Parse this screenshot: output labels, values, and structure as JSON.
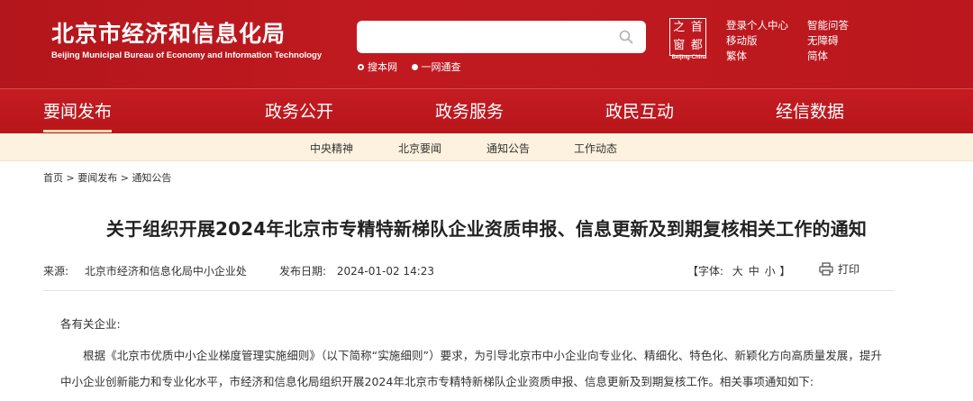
{
  "header": {
    "logo_cn": "北京市经济和信息化局",
    "logo_en": "Beijing Municipal Bureau of Economy and Information Technology",
    "search": {
      "placeholder": "",
      "options": [
        {
          "label": "搜本网",
          "selected": true
        },
        {
          "label": "一网通查",
          "selected": false
        }
      ]
    },
    "seal": {
      "chars": [
        "之",
        "首",
        "窗",
        "都"
      ],
      "caption": "Beijing-China"
    },
    "links": [
      "登录个人中心",
      "智能问答",
      "移动版",
      "无障碍",
      "繁体",
      "简体"
    ]
  },
  "nav": {
    "items": [
      "要闻发布",
      "政务公开",
      "政务服务",
      "政民互动",
      "经信数据"
    ],
    "active": "要闻发布"
  },
  "subnav": {
    "items": [
      "中央精神",
      "北京要闻",
      "通知公告",
      "工作动态"
    ]
  },
  "breadcrumb": {
    "items": [
      "首页",
      "要闻发布",
      "通知公告"
    ],
    "separator": ">"
  },
  "article": {
    "title": "关于组织开展2024年北京市专精特新梯队企业资质申报、信息更新及到期复核相关工作的通知",
    "source_label": "来源:",
    "source": "北京市经济和信息化局中小企业处",
    "date_label": "发布日期:",
    "date": "2024-01-02 14:23",
    "font_label_open": "【字体:",
    "font_sizes": [
      "大",
      "中",
      "小"
    ],
    "font_label_close": "】",
    "print_label": "打印",
    "greeting": "各有关企业:",
    "paragraph": "根据《北京市优质中小企业梯度管理实施细则》（以下简称“实施细则”）要求，为引导北京市中小企业向专业化、精细化、特色化、新颖化方向高质量发展，提升中小企业创新能力和专业化水平，市经济和信息化局组织开展2024年北京市专精特新梯队企业资质申报、信息更新及到期复核工作。相关事项通知如下:"
  },
  "colors": {
    "brand_red": "#b8161c",
    "subnav_bg": "#fdf1df",
    "nav_underline": "#f5d7a6"
  },
  "icons": [
    "search-icon",
    "printer-icon"
  ]
}
